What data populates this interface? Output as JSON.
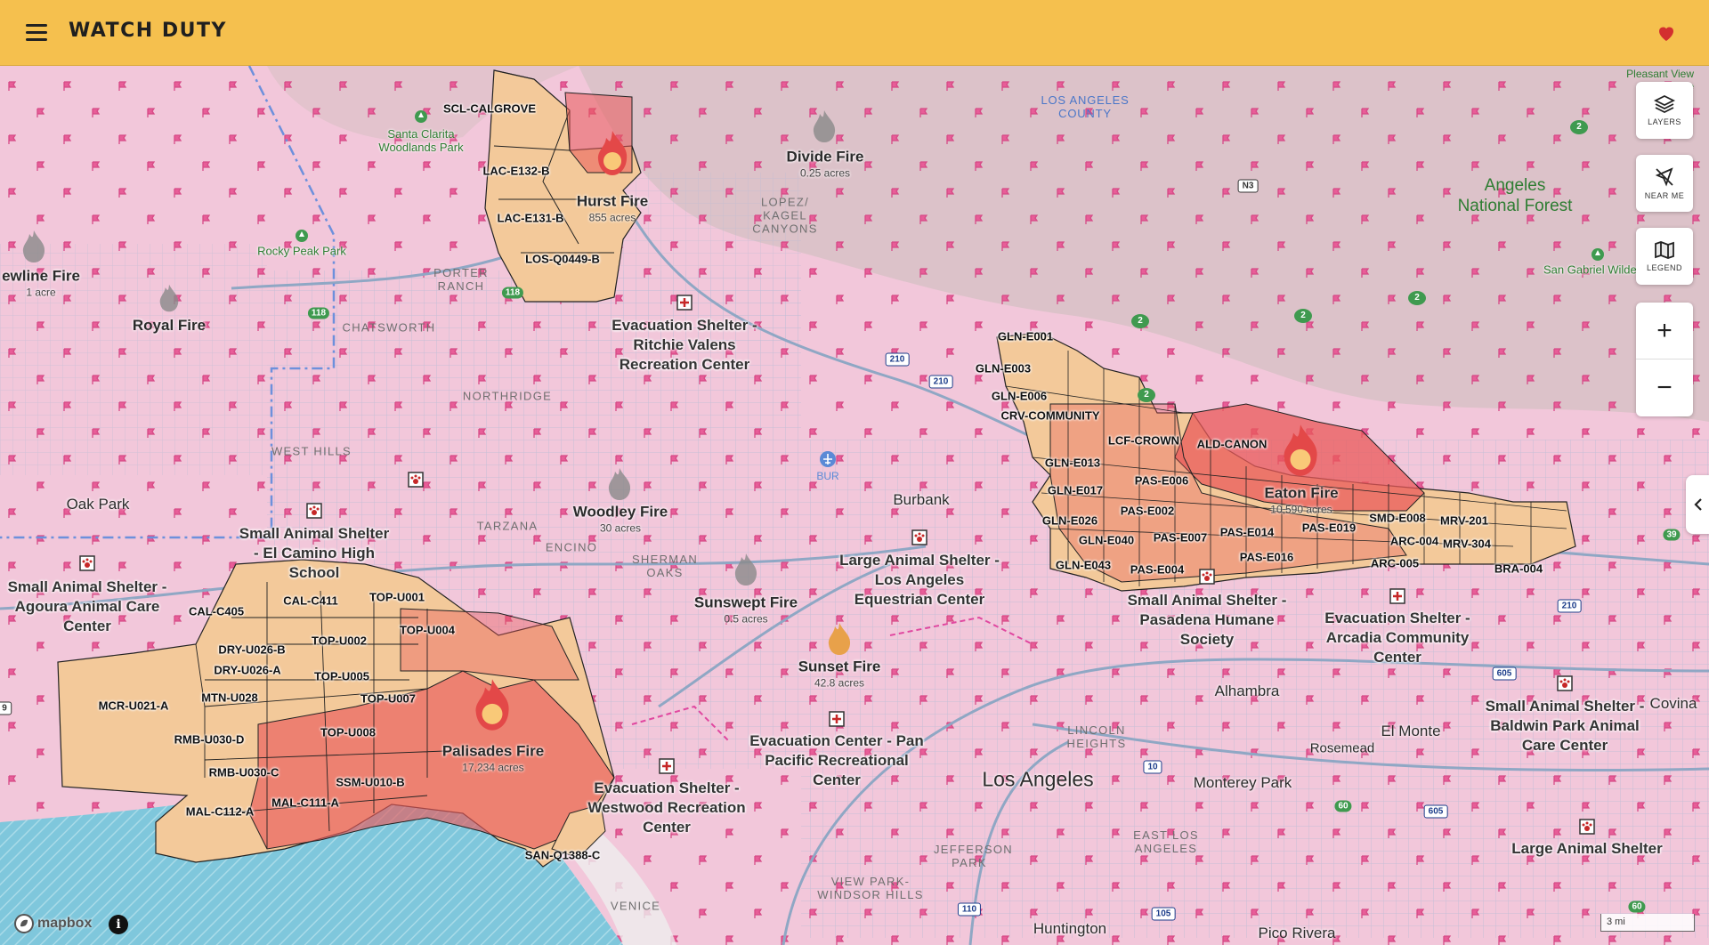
{
  "header": {
    "brand": "WATCH DUTY",
    "menu_icon": "hamburger-menu-icon",
    "favorite_icon": "heart-icon",
    "accent": "#f5c04e"
  },
  "controls": {
    "layers_label": "LAYERS",
    "near_me_label": "NEAR ME",
    "legend_label": "LEGEND",
    "zoom_in": "+",
    "zoom_out": "−"
  },
  "footer": {
    "attribution": "mapbox",
    "info": "i",
    "scale": "3 mi"
  },
  "fires": [
    {
      "name": "Hurst Fire",
      "acres": "855 acres",
      "active": true
    },
    {
      "name": "Divide Fire",
      "acres": "0.25 acres",
      "active": false
    },
    {
      "name": "ewline Fire",
      "acres": "1 acre",
      "active": false
    },
    {
      "name": "Royal Fire",
      "acres": "",
      "active": false
    },
    {
      "name": "Woodley Fire",
      "acres": "30 acres",
      "active": false
    },
    {
      "name": "Sunswept Fire",
      "acres": "0.5 acres",
      "active": false
    },
    {
      "name": "Sunset Fire",
      "acres": "42.8 acres",
      "active": false
    },
    {
      "name": "Palisades Fire",
      "acres": "17,234 acres",
      "active": true
    },
    {
      "name": "Eaton Fire",
      "acres": "10,590 acres",
      "active": true
    }
  ],
  "zones": [
    "SCL-CALGROVE",
    "LAC-E132-B",
    "LAC-E131-B",
    "LOS-Q0449-B",
    "GLN-E001",
    "GLN-E003",
    "GLN-E006",
    "CRV-COMMUNITY",
    "LCF-CROWN",
    "ALD-CANON",
    "GLN-E013",
    "PAS-E006",
    "GLN-E017",
    "PAS-E002",
    "GLN-E026",
    "GLN-E040",
    "PAS-E007",
    "PAS-E014",
    "PAS-E019",
    "SMD-E008",
    "MRV-201",
    "ARC-004",
    "MRV-304",
    "GLN-E043",
    "PAS-E004",
    "PAS-E016",
    "ARC-005",
    "BRA-004",
    "CAL-C405",
    "CAL-C411",
    "TOP-U001",
    "TOP-U004",
    "TOP-U002",
    "DRY-U026-B",
    "DRY-U026-A",
    "TOP-U005",
    "MTN-U028",
    "TOP-U007",
    "MCR-U021-A",
    "TOP-U008",
    "RMB-U030-D",
    "RMB-U030-C",
    "SSM-U010-B",
    "MAL-C112-A",
    "MAL-C111-A",
    "SAN-Q1388-C"
  ],
  "shelters": [
    "Evacuation Shelter - Ritchie Valens Recreation Center",
    "Small Animal Shelter - El Camino High School",
    "Small Animal Shelter - Agoura Animal Care Center",
    "Large Animal Shelter - Los Angeles Equestrian Center",
    "Small Animal Shelter - Pasadena Humane Society",
    "Evacuation Shelter - Arcadia Community Center",
    "Evacuation Center - Pan Pacific Recreational Center",
    "Evacuation Shelter - Westwood Recreation Center",
    "Small Animal Shelter - Baldwin Park Animal Care Center",
    "Large Animal Shelter"
  ],
  "places": [
    "Burbank",
    "Oak Park",
    "Alhambra",
    "El Monte",
    "Rosemead",
    "Los Angeles",
    "Monterey Park",
    "Covina",
    "Huntington",
    "Pico Rivera",
    "Pleasant View Ridge"
  ],
  "parks": [
    "Santa Clarita Woodlands Park",
    "Rocky Peak Park",
    "San Gabriel Wilden",
    "Angeles National Forest"
  ],
  "neighborhoods": [
    "LOS ANGELES COUNTY",
    "LOPEZ/ KAGEL CANYONS",
    "PORTER RANCH",
    "CHATSWORTH",
    "NORTHRIDGE",
    "WEST HILLS",
    "TARZANA",
    "ENCINO",
    "SHERMAN OAKS",
    "LINCOLN HEIGHTS",
    "EAST LOS ANGELES",
    "JEFFERSON PARK",
    "VIEW PARK-WINDSOR HILLS",
    "VENICE",
    "BUR"
  ],
  "highways": [
    "118",
    "118",
    "210",
    "210",
    "N3",
    "10",
    "60",
    "605",
    "605",
    "110",
    "105",
    "210",
    "39",
    "60",
    "9"
  ],
  "markers": [
    "2",
    "2",
    "2",
    "2",
    "2",
    "2"
  ],
  "colors": {
    "evac_zone_fill": "#f3c99a",
    "fire_perimeter": "#e34848",
    "map_base": "#f2c7da",
    "ocean": "#7fc7dc",
    "marker_green": "#3f9a4f"
  }
}
